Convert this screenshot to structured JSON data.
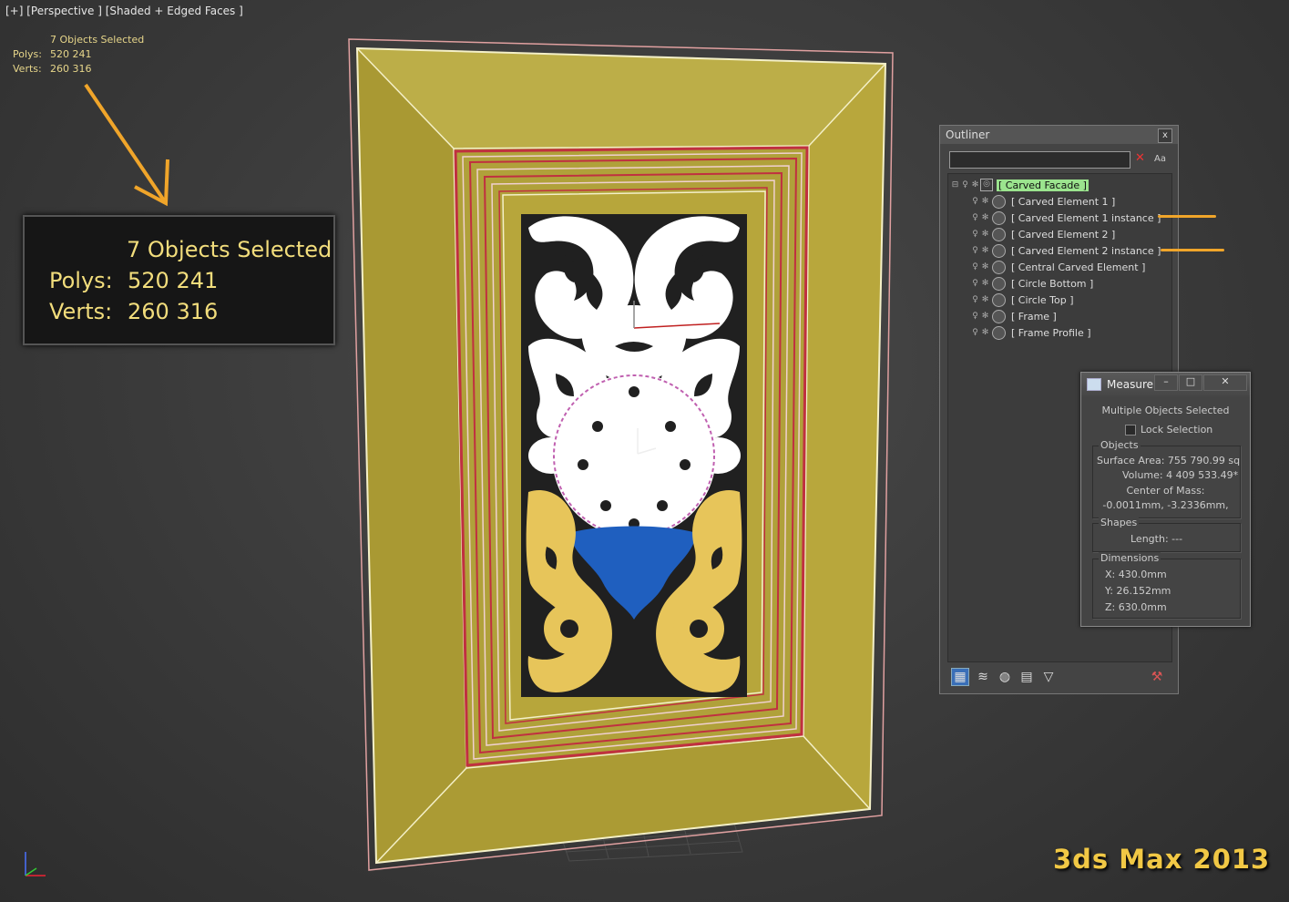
{
  "viewport": {
    "label": "[+] [Perspective ] [Shaded + Edged Faces ]",
    "stats": {
      "title": "7 Objects Selected",
      "polys_label": "Polys:",
      "polys_value": "520 241",
      "verts_label": "Verts:",
      "verts_value": "260 316"
    }
  },
  "stats_callout": {
    "title": "7 Objects Selected",
    "polys_label": "Polys:",
    "polys_value": "520 241",
    "verts_label": "Verts:",
    "verts_value": "260 316"
  },
  "outliner": {
    "title": "Outliner",
    "close": "x",
    "case_toggle": "Aa",
    "root": "[ Carved Facade ]",
    "items": [
      "[ Carved Element 1 ]",
      "[ Carved Element 1 instance ]",
      "[ Carved Element 2 ]",
      "[ Carved Element 2 instance ]",
      "[ Central Carved Element ]",
      "[ Circle Bottom ]",
      "[ Circle Top ]",
      "[ Frame ]",
      "[ Frame Profile ]"
    ],
    "toolbar_icons": [
      "hierarchy-mode-icon",
      "layer-mode-icon",
      "material-mode-icon",
      "rename-icon",
      "filter-icon",
      "settings-icon"
    ]
  },
  "measure": {
    "title": "Measure",
    "status": "Multiple Objects Selected",
    "lock_selection": "Lock Selection",
    "objects_group": "Objects",
    "surface_area": "Surface Area:  755 790.99 sq",
    "volume": "Volume:  4 409 533.49*",
    "center_of_mass_label": "Center of Mass:",
    "center_of_mass_value": "-0.0011mm, -3.2336mm,",
    "shapes_group": "Shapes",
    "length": "Length:  ---",
    "dimensions_group": "Dimensions",
    "dim_x": "X:   430.0mm",
    "dim_y": "Y:   26.152mm",
    "dim_z": "Z:   630.0mm"
  },
  "brand": "3ds Max 2013",
  "colors": {
    "frame": "#b9a83b",
    "carving_white": "#ffffff",
    "carving_gold": "#e7c55a",
    "carving_blue": "#1f5fbf",
    "highlight": "#f0a52a"
  }
}
